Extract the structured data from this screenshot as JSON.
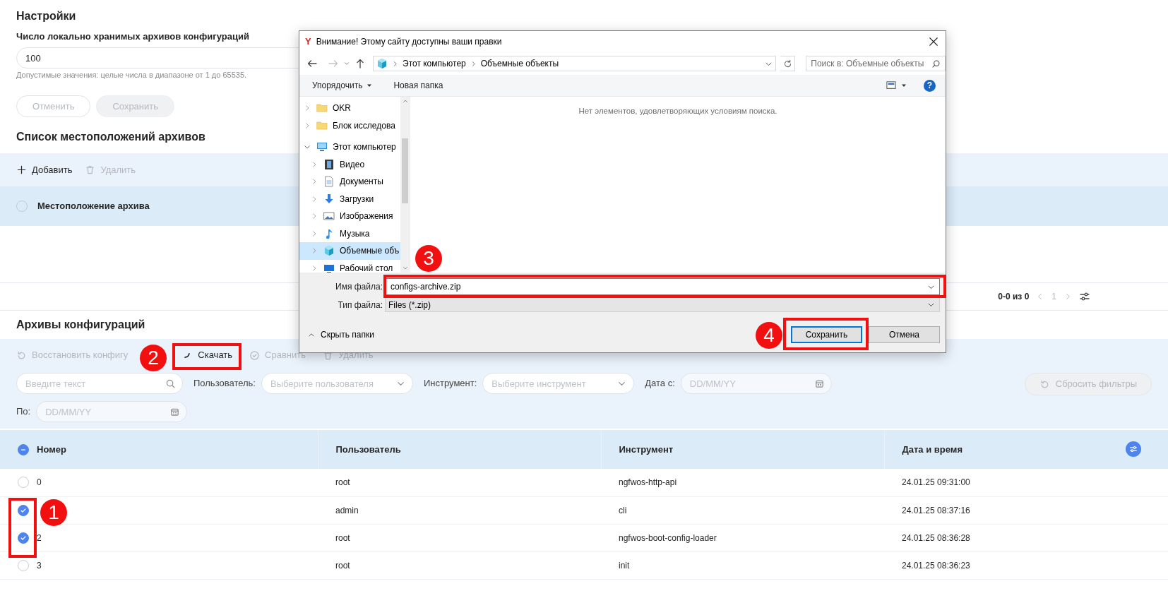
{
  "settings": {
    "title": "Настройки",
    "field_label": "Число локально хранимых архивов конфигураций",
    "field_value": "100",
    "hint": "Допустимые значения: целые числа в диапазоне от 1 до 65535.",
    "buttons": [
      {
        "kind": "outline",
        "label": "Отменить",
        "disabled": true
      },
      {
        "kind": "filled",
        "label": "Сохранить",
        "disabled": true
      }
    ]
  },
  "locations": {
    "title": "Список местоположений архивов",
    "toolbar": [
      {
        "kind": "add",
        "label": "Добавить",
        "disabled": false
      },
      {
        "kind": "delete",
        "label": "Удалить",
        "disabled": true
      }
    ],
    "select_all": {
      "indeterminate": false
    },
    "columns": [
      "Местоположение архива"
    ],
    "pagination": {
      "range": "0-0 из 0",
      "page": "1"
    }
  },
  "archives": {
    "title": "Архивы конфигураций",
    "toolbar": [
      {
        "kind": "restore",
        "label": "Восстановить конфигу",
        "disabled": true
      },
      {
        "kind": "download",
        "label": "Скачать",
        "disabled": false
      },
      {
        "kind": "compare",
        "label": "Сравнить",
        "disabled": true
      },
      {
        "kind": "delete",
        "label": "Удалить",
        "disabled": true
      }
    ],
    "filters": [
      {
        "kind": "search",
        "placeholder": "Введите текст"
      },
      {
        "kind": "select",
        "label": "Пользователь:",
        "placeholder": "Выберите пользователя"
      },
      {
        "kind": "select",
        "label": "Инструмент:",
        "placeholder": "Выберите инструмент"
      },
      {
        "kind": "date",
        "label": "Дата с:",
        "placeholder": "DD/MM/YY"
      },
      {
        "kind": "date",
        "label": "По:",
        "placeholder": "DD/MM/YY"
      }
    ],
    "reset_button": {
      "label": "Сбросить фильтры",
      "disabled": true
    },
    "select_all": {
      "indeterminate": true
    },
    "columns": [
      "Номер",
      "Пользователь",
      "Инструмент",
      "Дата и время"
    ],
    "rows": [
      {
        "selected": false,
        "number": "0",
        "user": "root",
        "tool": "ngfwos-http-api",
        "datetime": "24.01.25 09:31:00"
      },
      {
        "selected": true,
        "user": "admin",
        "tool": "cli",
        "datetime": "24.01.25 08:37:16"
      },
      {
        "selected": true,
        "number": "2",
        "user": "root",
        "tool": "ngfwos-boot-config-loader",
        "datetime": "24.01.25 08:36:28"
      },
      {
        "selected": false,
        "number": "3",
        "user": "root",
        "tool": "init",
        "datetime": "24.01.25 08:36:23"
      }
    ]
  },
  "dialog": {
    "app_icon": "Y",
    "title": "Внимание! Этому сайту доступны ваши правки",
    "path": [
      "Этот компьютер",
      "Объемные объекты"
    ],
    "search_placeholder": "Поиск в: Объемные объекты",
    "commands": [
      "Упорядочить",
      "Новая папка"
    ],
    "help": "?",
    "tree": [
      {
        "kind": "folder",
        "label": "OKR",
        "expanded": false,
        "selected": false
      },
      {
        "kind": "folder",
        "label": "Блок исследова",
        "expanded": false,
        "selected": false
      },
      {
        "kind": "computer",
        "label": "Этот компьютер",
        "expanded": true,
        "selected": false,
        "children": [
          {
            "kind": "video",
            "label": "Видео",
            "expanded": false,
            "selected": false
          },
          {
            "kind": "documents",
            "label": "Документы",
            "expanded": false,
            "selected": false
          },
          {
            "kind": "downloads",
            "label": "Загрузки",
            "expanded": false,
            "selected": false
          },
          {
            "kind": "pictures",
            "label": "Изображения",
            "expanded": false,
            "selected": false
          },
          {
            "kind": "music",
            "label": "Музыка",
            "expanded": false,
            "selected": false
          },
          {
            "kind": "objects3d",
            "label": "Объемные объ",
            "expanded": false,
            "selected": true
          },
          {
            "kind": "desktop",
            "label": "Рабочий стол",
            "expanded": false,
            "selected": false
          }
        ]
      }
    ],
    "empty_message": "Нет элементов, удовлетворяющих условиям поиска.",
    "filename_label": "Имя файла:",
    "filename": "configs-archive.zip",
    "filetype_label": "Тип файла:",
    "filetype": "Files (*.zip)",
    "hide_folders": "Скрыть папки",
    "buttons": [
      {
        "label": "Сохранить",
        "default": true
      },
      {
        "label": "Отмена",
        "default": false
      }
    ]
  },
  "callouts": [
    {
      "label": "1"
    },
    {
      "label": "2"
    },
    {
      "label": "3"
    },
    {
      "label": "4"
    }
  ]
}
